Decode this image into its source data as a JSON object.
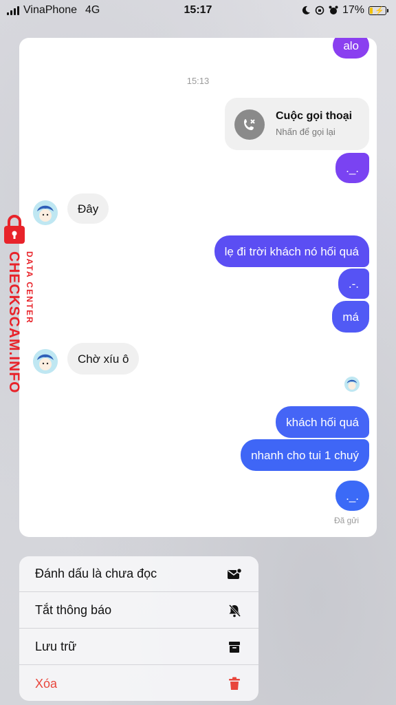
{
  "status_bar": {
    "carrier": "VinaPhone",
    "network": "4G",
    "time": "15:17",
    "battery": "17%"
  },
  "chat": {
    "time_label": "15:13",
    "call": {
      "title": "Cuộc gọi thoại",
      "subtitle": "Nhấn để gọi lại"
    },
    "messages": {
      "m0": "alo",
      "m1": "._.",
      "m2": "Đây",
      "m3": "lẹ đi trời khách nó hối quá",
      "m4": ".-.",
      "m5": "má",
      "m6": "Chờ xíu ô",
      "m7": "khách hối quá",
      "m8": "nhanh cho tui 1 chuý",
      "m9": "._."
    },
    "sent_label": "Đã gửi"
  },
  "watermark": {
    "brand": "CHECKSCAM.INFO",
    "sub": "DATA CENTER"
  },
  "menu": {
    "items": [
      {
        "label": "Đánh dấu là chưa đọc",
        "icon": "mark-unread-icon"
      },
      {
        "label": "Tắt thông báo",
        "icon": "bell-off-icon"
      },
      {
        "label": "Lưu trữ",
        "icon": "archive-icon"
      },
      {
        "label": "Xóa",
        "icon": "trash-icon"
      }
    ]
  },
  "colors": {
    "bubble_purple": "#8a3ff0",
    "bubble_blue": "#3f63f5",
    "danger": "#e8463c",
    "watermark_red": "#e8232a"
  }
}
